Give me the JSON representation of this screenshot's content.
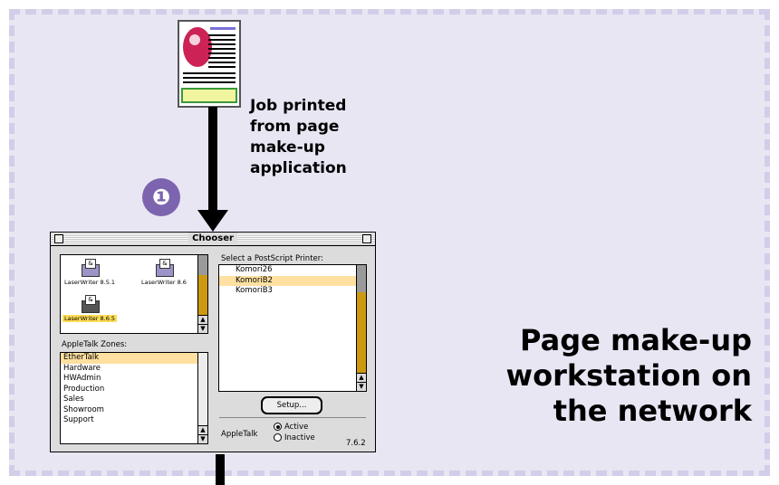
{
  "caption": {
    "lines": [
      "Job printed",
      "from page",
      "make-up",
      "application"
    ]
  },
  "step_number": "❶",
  "title": {
    "lines": [
      "Page make-up",
      "workstation on",
      "the network"
    ]
  },
  "chooser": {
    "window_title": "Chooser",
    "drivers": [
      {
        "name": "LaserWriter 8.5.1",
        "selected": false
      },
      {
        "name": "LaserWriter 8.6",
        "selected": false
      },
      {
        "name": "LaserWriter 8.6.5",
        "selected": true
      }
    ],
    "zones_label": "AppleTalk Zones:",
    "zones": [
      "EtherTalk",
      "Hardware",
      "HWAdmin",
      "Production",
      "Sales",
      "Showroom",
      "Support"
    ],
    "selected_zone": "EtherTalk",
    "printers_label": "Select a PostScript Printer:",
    "printers": [
      "Komori26",
      "KomoriB2",
      "KomoriB3"
    ],
    "selected_printer": "KomoriB2",
    "setup_label": "Setup...",
    "appletalk_label": "AppleTalk",
    "active_label": "Active",
    "inactive_label": "Inactive",
    "appletalk_state": "Active",
    "version": "7.6.2"
  },
  "colors": {
    "panel_bg": "#e9e6f4",
    "panel_border": "#d2cde8",
    "badge": "#7c64ae",
    "selection": "#ffe0a0",
    "scroll_track": "#cc9911"
  }
}
